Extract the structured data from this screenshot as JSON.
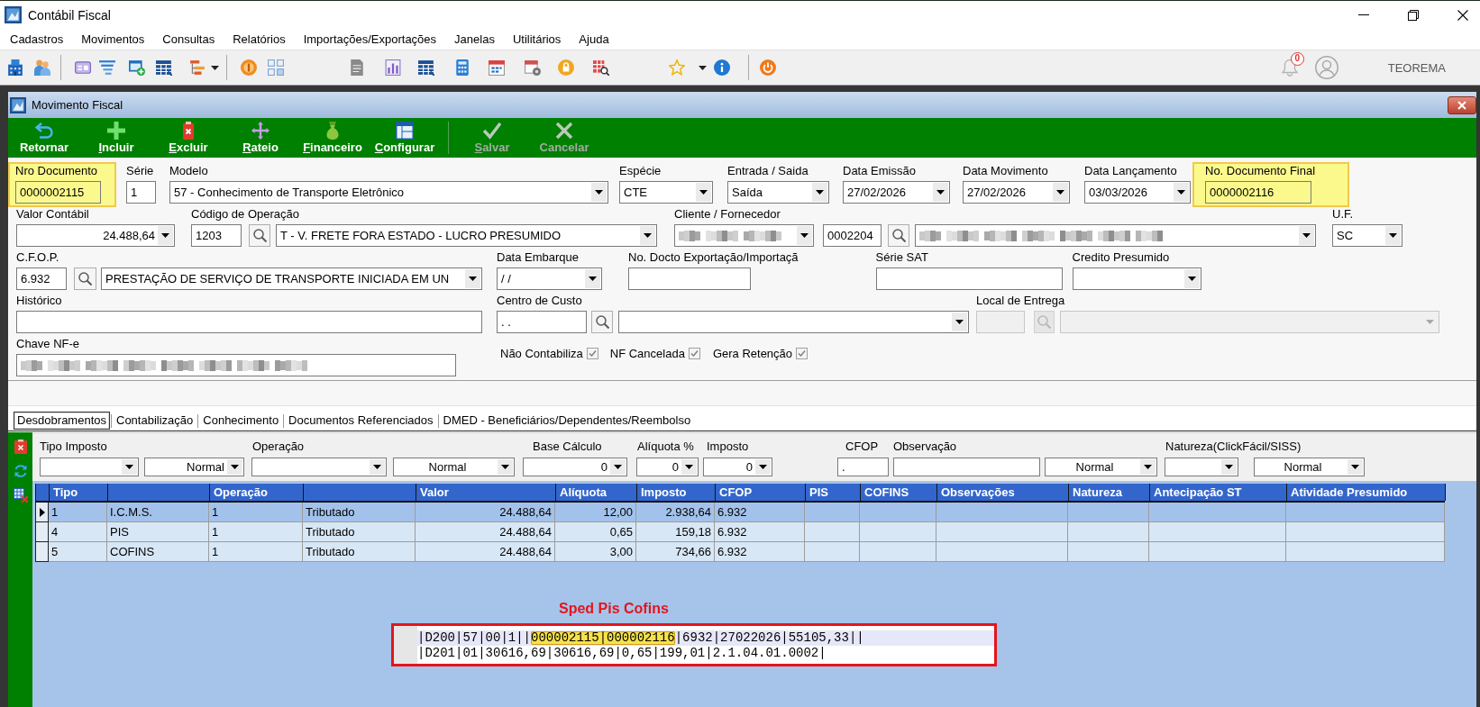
{
  "window": {
    "title": "Contábil Fiscal"
  },
  "menu": [
    "Cadastros",
    "Movimentos",
    "Consultas",
    "Relatórios",
    "Importações/Exportações",
    "Janelas",
    "Utilitários",
    "Ajuda"
  ],
  "toolbar": {
    "notification_count": "0",
    "user_name": "TEOREMA"
  },
  "document_window": {
    "title": "Movimento Fiscal",
    "actions": [
      {
        "label": "Retornar",
        "mnemonic": false,
        "disabled": false
      },
      {
        "label": "Incluir",
        "mnemonic": true,
        "disabled": false
      },
      {
        "label": "Excluir",
        "mnemonic": true,
        "disabled": false
      },
      {
        "label": "Rateio",
        "mnemonic": true,
        "disabled": false
      },
      {
        "label": "Financeiro",
        "mnemonic": true,
        "disabled": false
      },
      {
        "label": "Configurar",
        "mnemonic": true,
        "disabled": false
      },
      {
        "label": "Salvar",
        "mnemonic": true,
        "disabled": true
      },
      {
        "label": "Cancelar",
        "mnemonic": false,
        "disabled": true
      }
    ],
    "form_rows": [
      [
        {
          "kind": "field",
          "label": "Nro Documento",
          "highlighted": true,
          "disabled": false,
          "controls": [
            {
              "kind": "input",
              "value": "0000002115"
            }
          ]
        },
        {
          "kind": "field",
          "label": "Série",
          "highlighted": false,
          "disabled": false,
          "controls": [
            {
              "kind": "input",
              "value": "1"
            }
          ]
        },
        {
          "kind": "field",
          "label": "Modelo",
          "highlighted": false,
          "disabled": false,
          "controls": [
            {
              "kind": "dropdown",
              "value": "57 - Conhecimento de Transporte Eletrônico"
            }
          ]
        },
        {
          "kind": "field",
          "label": "Espécie",
          "highlighted": false,
          "disabled": false,
          "controls": [
            {
              "kind": "dropdown",
              "value": "CTE"
            }
          ]
        },
        {
          "kind": "field",
          "label": "Entrada / Saida",
          "highlighted": false,
          "disabled": false,
          "controls": [
            {
              "kind": "dropdown",
              "value": "Saída"
            }
          ]
        },
        {
          "kind": "field",
          "label": "Data Emissão",
          "highlighted": false,
          "disabled": false,
          "controls": [
            {
              "kind": "dropdown",
              "value": "27/02/2026"
            }
          ]
        },
        {
          "kind": "field",
          "label": "Data Movimento",
          "highlighted": false,
          "disabled": false,
          "controls": [
            {
              "kind": "dropdown",
              "value": "27/02/2026"
            }
          ]
        },
        {
          "kind": "field",
          "label": "Data Lançamento",
          "highlighted": false,
          "disabled": false,
          "controls": [
            {
              "kind": "dropdown",
              "value": "03/03/2026"
            }
          ]
        },
        {
          "kind": "field",
          "label": "No. Documento Final",
          "highlighted": true,
          "disabled": false,
          "controls": [
            {
              "kind": "input",
              "value": "0000002116"
            }
          ]
        }
      ],
      [
        {
          "kind": "field",
          "label": "Valor Contábil",
          "highlighted": false,
          "disabled": false,
          "controls": [
            {
              "kind": "dropdown",
              "value": "24.488,64"
            }
          ]
        },
        {
          "kind": "field",
          "label": "Código de Operação",
          "highlighted": false,
          "disabled": false,
          "controls": [
            {
              "kind": "input",
              "value": "1203"
            },
            {
              "kind": "search"
            },
            {
              "kind": "dropdown",
              "value": "T - V. FRETE FORA ESTADO - LUCRO PRESUMIDO"
            }
          ]
        },
        {
          "kind": "field",
          "label": "Cliente / Fornecedor",
          "highlighted": false,
          "disabled": false,
          "controls": [
            {
              "kind": "blurred_dropdown"
            },
            {
              "kind": "input",
              "value": "0002204"
            },
            {
              "kind": "search"
            },
            {
              "kind": "blurred_dropdown"
            }
          ]
        },
        {
          "kind": "field",
          "label": "U.F.",
          "highlighted": false,
          "disabled": false,
          "controls": [
            {
              "kind": "dropdown",
              "value": "SC"
            }
          ]
        }
      ],
      [
        {
          "kind": "field",
          "label": "C.F.O.P.",
          "highlighted": false,
          "disabled": false,
          "controls": [
            {
              "kind": "input",
              "value": "6.932"
            },
            {
              "kind": "search"
            },
            {
              "kind": "dropdown",
              "value": "PRESTAÇÃO DE SERVIÇO DE TRANSPORTE INICIADA EM UN"
            }
          ]
        },
        {
          "kind": "field",
          "label": "Data Embarque",
          "highlighted": false,
          "disabled": false,
          "controls": [
            {
              "kind": "dropdown",
              "value": "/ /"
            }
          ]
        },
        {
          "kind": "field",
          "label": "No. Docto Exportação/Importaçã",
          "highlighted": false,
          "disabled": false,
          "controls": [
            {
              "kind": "input"
            }
          ]
        },
        {
          "kind": "field",
          "label": "Série SAT",
          "highlighted": false,
          "disabled": false,
          "controls": [
            {
              "kind": "input"
            }
          ]
        },
        {
          "kind": "field",
          "label": "Credito Presumido",
          "highlighted": false,
          "disabled": false,
          "controls": [
            {
              "kind": "dropdown"
            }
          ]
        }
      ],
      [
        {
          "kind": "field",
          "label": "Histórico",
          "highlighted": false,
          "disabled": false,
          "controls": [
            {
              "kind": "input"
            }
          ]
        },
        {
          "kind": "field",
          "label": "Centro de Custo",
          "highlighted": false,
          "disabled": false,
          "controls": [
            {
              "kind": "input",
              "value": ". ."
            },
            {
              "kind": "search"
            },
            {
              "kind": "dropdown"
            }
          ]
        },
        {
          "kind": "field",
          "label": "Local de Entrega",
          "highlighted": false,
          "disabled": true,
          "controls": [
            {
              "kind": "input"
            },
            {
              "kind": "search"
            },
            {
              "kind": "dropdown"
            }
          ]
        }
      ],
      [
        {
          "kind": "field",
          "label": "Chave NF-e",
          "highlighted": false,
          "disabled": false,
          "controls": [
            {
              "kind": "blurred_input"
            }
          ]
        },
        {
          "kind": "checkbox",
          "label": "Não Contabiliza",
          "checked": true
        },
        {
          "kind": "checkbox",
          "label": "NF Cancelada",
          "checked": true
        },
        {
          "kind": "checkbox",
          "label": "Gera Retenção",
          "checked": true
        }
      ]
    ],
    "tabs": [
      {
        "label": "Desdobramentos",
        "selected": true
      },
      {
        "label": "Contabilização",
        "selected": false
      },
      {
        "label": "Conhecimento",
        "selected": false
      },
      {
        "label": "Documentos Referenciados",
        "selected": false
      },
      {
        "label": "DMED - Beneficiários/Dependentes/Reembolso",
        "selected": false
      }
    ],
    "filters": [
      {
        "kind": "dropdown",
        "label": "Tipo Imposto"
      },
      {
        "kind": "dropdown",
        "value": "Normal"
      },
      {
        "kind": "dropdown",
        "label": "Operação"
      },
      {
        "kind": "dropdown",
        "value": "Normal"
      },
      {
        "kind": "dropdown",
        "label": "Base Cálculo",
        "value": "0"
      },
      {
        "kind": "dropdown",
        "label": "Alíquota %",
        "value": "0"
      },
      {
        "kind": "dropdown",
        "label": "Imposto",
        "value": "0"
      },
      {
        "kind": "input",
        "label": "CFOP",
        "value": "."
      },
      {
        "kind": "input",
        "label": "Observação"
      },
      {
        "kind": "dropdown",
        "value": "Normal"
      },
      {
        "kind": "dropdown",
        "label": "Natureza(ClickFácil/SISS)"
      },
      {
        "kind": "dropdown",
        "value": "Normal"
      }
    ],
    "grid": {
      "columns": [
        "Tipo",
        null,
        "Operação",
        null,
        "Valor",
        "Alíquota",
        "Imposto",
        "CFOP",
        "PIS",
        "COFINS",
        "Observações",
        "Natureza",
        "Antecipação ST",
        "Atividade Presumido"
      ],
      "rows": [
        {
          "selected": true,
          "cells": [
            "1",
            "I.C.M.S.",
            "1",
            "Tributado",
            "24.488,64",
            "12,00",
            "2.938,64",
            "6.932",
            null,
            null,
            null,
            null,
            null,
            null
          ]
        },
        {
          "selected": false,
          "cells": [
            "4",
            "PIS",
            "1",
            "Tributado",
            "24.488,64",
            "0,65",
            "159,18",
            "6.932",
            null,
            null,
            null,
            null,
            null,
            null
          ]
        },
        {
          "selected": false,
          "cells": [
            "5",
            "COFINS",
            "1",
            "Tributado",
            "24.488,64",
            "3,00",
            "734,66",
            "6.932",
            null,
            null,
            null,
            null,
            null,
            null
          ]
        }
      ]
    }
  },
  "annotation": {
    "title": "Sped Pis Cofins",
    "lines": [
      {
        "current": true,
        "segments": [
          {
            "text": "|D200|57|00|1||",
            "highlighted": false
          },
          {
            "text": "000002115|000002116",
            "highlighted": true
          },
          {
            "text": "|6932|27022026|55105,33||",
            "highlighted": false
          }
        ]
      },
      {
        "current": false,
        "segments": [
          {
            "text": "|D201|01|30616,69|30616,69|0,65|199,01|2.1.04.01.0002|",
            "highlighted": false
          }
        ]
      }
    ]
  }
}
